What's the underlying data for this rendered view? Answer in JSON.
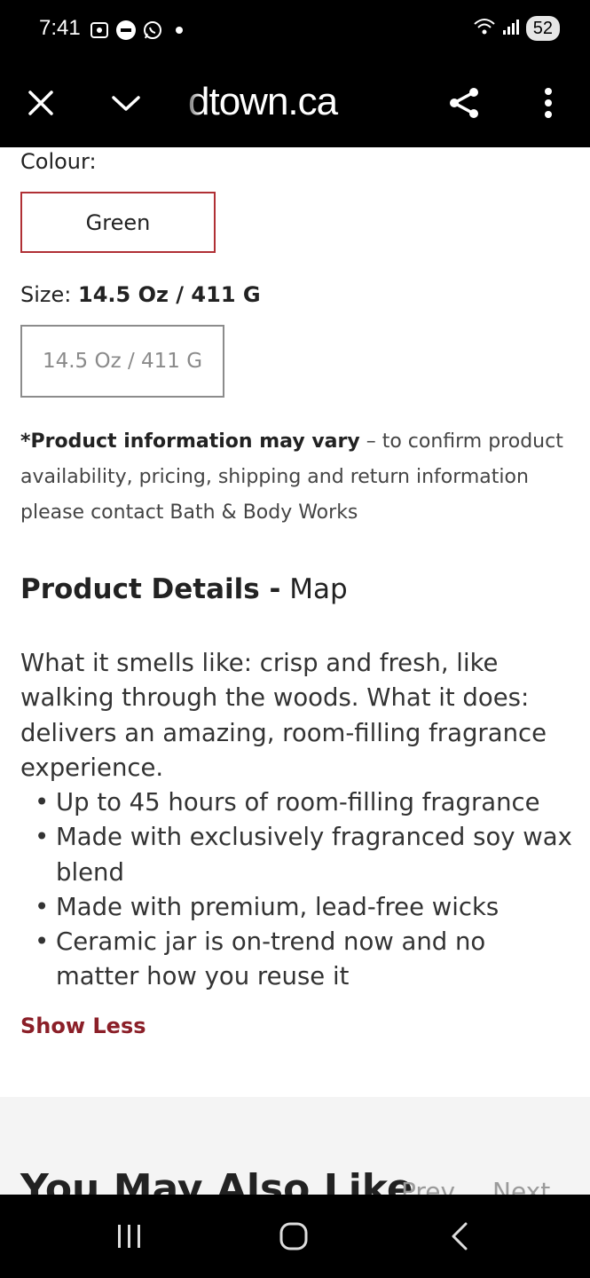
{
  "status_bar": {
    "time": "7:41",
    "battery": "52",
    "icons": [
      "screenshot-icon",
      "news-icon",
      "whatsapp-icon",
      "notification-dot",
      "wifi-icon",
      "signal-icon"
    ]
  },
  "browser": {
    "url": "dtown.ca",
    "close_icon": "close-icon",
    "dropdown_icon": "chevron-down-icon",
    "share_icon": "share-icon",
    "menu_icon": "more-vert-icon"
  },
  "product": {
    "colour_label": "Colour:",
    "colour_value": "Green",
    "size_label": "Size:",
    "size_value": "14.5 Oz / 411 G",
    "size_option": "14.5 Oz / 411 G",
    "disclaimer_bold": "*Product information may vary",
    "disclaimer_text": " – to confirm product availability, pricing, shipping and return information please contact Bath & Body Works",
    "details_heading": "Product Details -",
    "details_subheading": " Map",
    "description": "What it smells like: crisp and fresh, like walking through the woods. What it does: delivers an amazing, room-filling fragrance experience.",
    "bullets": [
      "Up to 45 hours of room-filling fragrance",
      "Made with exclusively fragranced soy wax blend",
      "Made with premium, lead-free wicks",
      "Ceramic jar is on-trend now and no matter how you reuse it"
    ],
    "show_less": "Show Less"
  },
  "recommendations": {
    "title": "You May Also Like",
    "prev": "Prev",
    "next": "Next"
  },
  "colors": {
    "accent": "#b03035",
    "link": "#8b1f28",
    "band": "#f4f4f4"
  }
}
